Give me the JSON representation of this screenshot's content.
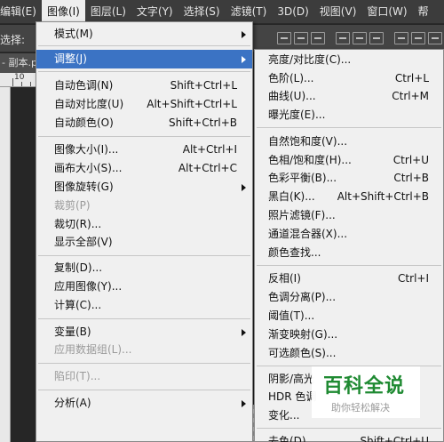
{
  "menubar": {
    "items": [
      "编辑(E)",
      "图像(I)",
      "图层(L)",
      "文字(Y)",
      "选择(S)",
      "滤镜(T)",
      "3D(D)",
      "视图(V)",
      "窗口(W)",
      "帮"
    ]
  },
  "options_bar": {
    "label": "选择:"
  },
  "document": {
    "tab_label": "- 副本.p",
    "ruler_tick": "10"
  },
  "image_menu": {
    "items": [
      {
        "label": "模式(M)",
        "shortcut": "",
        "submenu": true,
        "disabled": false,
        "highlighted": false
      },
      {
        "label": "调整(J)",
        "shortcut": "",
        "submenu": true,
        "disabled": false,
        "highlighted": true
      },
      {
        "label": "自动色调(N)",
        "shortcut": "Shift+Ctrl+L",
        "submenu": false,
        "disabled": false,
        "highlighted": false
      },
      {
        "label": "自动对比度(U)",
        "shortcut": "Alt+Shift+Ctrl+L",
        "submenu": false,
        "disabled": false,
        "highlighted": false
      },
      {
        "label": "自动颜色(O)",
        "shortcut": "Shift+Ctrl+B",
        "submenu": false,
        "disabled": false,
        "highlighted": false
      },
      {
        "label": "图像大小(I)...",
        "shortcut": "Alt+Ctrl+I",
        "submenu": false,
        "disabled": false,
        "highlighted": false
      },
      {
        "label": "画布大小(S)...",
        "shortcut": "Alt+Ctrl+C",
        "submenu": false,
        "disabled": false,
        "highlighted": false
      },
      {
        "label": "图像旋转(G)",
        "shortcut": "",
        "submenu": true,
        "disabled": false,
        "highlighted": false
      },
      {
        "label": "裁剪(P)",
        "shortcut": "",
        "submenu": false,
        "disabled": true,
        "highlighted": false
      },
      {
        "label": "裁切(R)...",
        "shortcut": "",
        "submenu": false,
        "disabled": false,
        "highlighted": false
      },
      {
        "label": "显示全部(V)",
        "shortcut": "",
        "submenu": false,
        "disabled": false,
        "highlighted": false
      },
      {
        "label": "复制(D)...",
        "shortcut": "",
        "submenu": false,
        "disabled": false,
        "highlighted": false
      },
      {
        "label": "应用图像(Y)...",
        "shortcut": "",
        "submenu": false,
        "disabled": false,
        "highlighted": false
      },
      {
        "label": "计算(C)...",
        "shortcut": "",
        "submenu": false,
        "disabled": false,
        "highlighted": false
      },
      {
        "label": "变量(B)",
        "shortcut": "",
        "submenu": true,
        "disabled": false,
        "highlighted": false
      },
      {
        "label": "应用数据组(L)...",
        "shortcut": "",
        "submenu": false,
        "disabled": true,
        "highlighted": false
      },
      {
        "label": "陷印(T)...",
        "shortcut": "",
        "submenu": false,
        "disabled": true,
        "highlighted": false
      },
      {
        "label": "分析(A)",
        "shortcut": "",
        "submenu": true,
        "disabled": false,
        "highlighted": false
      }
    ]
  },
  "adjust_menu": {
    "items": [
      {
        "label": "亮度/对比度(C)...",
        "shortcut": ""
      },
      {
        "label": "色阶(L)...",
        "shortcut": "Ctrl+L"
      },
      {
        "label": "曲线(U)...",
        "shortcut": "Ctrl+M"
      },
      {
        "label": "曝光度(E)...",
        "shortcut": ""
      },
      {
        "label": "自然饱和度(V)...",
        "shortcut": ""
      },
      {
        "label": "色相/饱和度(H)...",
        "shortcut": "Ctrl+U"
      },
      {
        "label": "色彩平衡(B)...",
        "shortcut": "Ctrl+B"
      },
      {
        "label": "黑白(K)...",
        "shortcut": "Alt+Shift+Ctrl+B"
      },
      {
        "label": "照片滤镜(F)...",
        "shortcut": ""
      },
      {
        "label": "通道混合器(X)...",
        "shortcut": ""
      },
      {
        "label": "颜色查找...",
        "shortcut": ""
      },
      {
        "label": "反相(I)",
        "shortcut": "Ctrl+I"
      },
      {
        "label": "色调分离(P)...",
        "shortcut": ""
      },
      {
        "label": "阈值(T)...",
        "shortcut": ""
      },
      {
        "label": "渐变映射(G)...",
        "shortcut": ""
      },
      {
        "label": "可选颜色(S)...",
        "shortcut": ""
      },
      {
        "label": "阴影/高光",
        "shortcut": ""
      },
      {
        "label": "HDR 色调",
        "shortcut": ""
      },
      {
        "label": "变化...",
        "shortcut": ""
      },
      {
        "label": "去色(D)",
        "shortcut": "Shift+Ctrl+U"
      }
    ]
  },
  "watermark": {
    "title": "百科全说",
    "subtitle": "助你轻松解决"
  },
  "colors": {
    "highlight": "#3b73c4",
    "menu_bg": "#f0f0f0",
    "menubar_bg": "#3c3c3c",
    "watermark_green": "#1f8a32"
  }
}
